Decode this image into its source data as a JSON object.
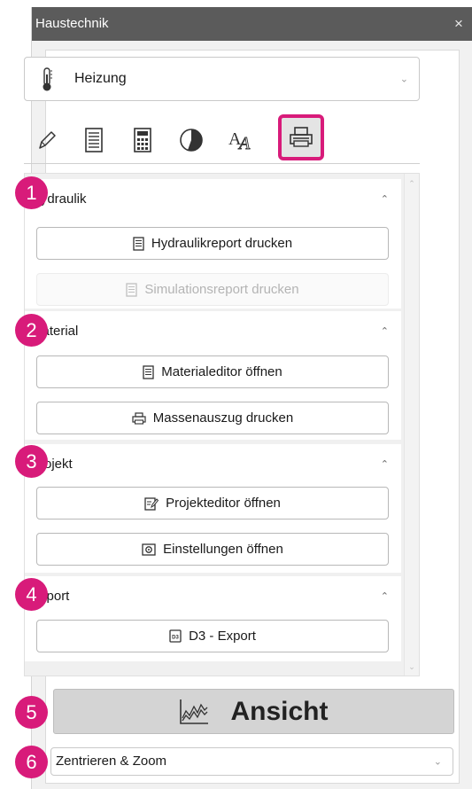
{
  "window": {
    "title": "Haustechnik",
    "close_symbol": "×"
  },
  "system_select": {
    "value": "Heizung",
    "icon": "thermometer-icon"
  },
  "toolbar": {
    "tools": [
      {
        "name": "pencil-icon"
      },
      {
        "name": "list-icon"
      },
      {
        "name": "calculator-icon"
      },
      {
        "name": "pie-chart-icon"
      },
      {
        "name": "text-style-icon"
      },
      {
        "name": "printer-icon",
        "active": true
      }
    ]
  },
  "sections": [
    {
      "title": "Hydraulik",
      "badge": "1",
      "buttons": [
        {
          "label": "Hydraulikreport drucken",
          "icon": "document-icon",
          "enabled": true
        },
        {
          "label": "Simulationsreport drucken",
          "icon": "document-icon",
          "enabled": false
        }
      ]
    },
    {
      "title": "Material",
      "badge": "2",
      "buttons": [
        {
          "label": "Materialeditor öffnen",
          "icon": "document-icon",
          "enabled": true
        },
        {
          "label": "Massenauszug drucken",
          "icon": "printer-icon",
          "enabled": true
        }
      ]
    },
    {
      "title": "Projekt",
      "badge": "3",
      "buttons": [
        {
          "label": "Projekteditor öffnen",
          "icon": "edit-document-icon",
          "enabled": true
        },
        {
          "label": "Einstellungen öffnen",
          "icon": "settings-icon",
          "enabled": true
        }
      ]
    },
    {
      "title": "Export",
      "badge": "4",
      "buttons": [
        {
          "label": "D3 - Export",
          "icon": "d3-file-icon",
          "enabled": true
        }
      ]
    }
  ],
  "view_button": {
    "label": "Ansicht",
    "icon": "chart-icon",
    "badge": "5"
  },
  "zoom_select": {
    "value": "Zentrieren & Zoom",
    "badge": "6"
  },
  "colors": {
    "accent": "#d81b7a",
    "titlebar": "#5b5b5b"
  }
}
